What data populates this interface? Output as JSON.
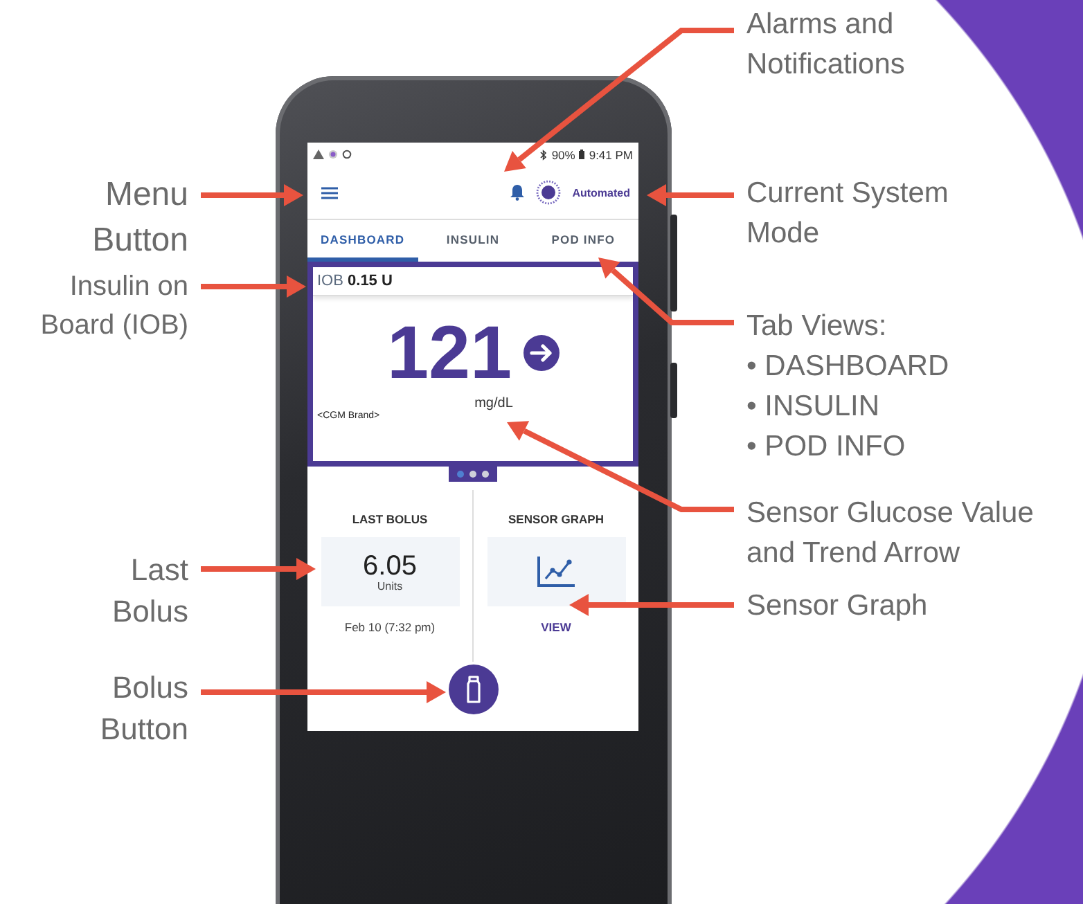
{
  "annotations_left": [
    {
      "text": "Menu\nButton"
    },
    {
      "text": "Insulin on\nBoard (IOB)"
    },
    {
      "text": "Last\nBolus"
    },
    {
      "text": "Bolus\nButton"
    }
  ],
  "annotations_right": [
    {
      "kind": "text",
      "text": "Alarms and\nNotifications"
    },
    {
      "kind": "text",
      "text": "Current System\nMode"
    },
    {
      "kind": "list",
      "text": "Tab Views:",
      "items": [
        "• DASHBOARD",
        "• INSULIN",
        "• POD INFO"
      ]
    },
    {
      "kind": "text",
      "text": "Sensor Glucose Value\nand Trend Arrow"
    },
    {
      "kind": "text",
      "text": "Sensor Graph"
    }
  ],
  "status_bar": {
    "battery": "90%",
    "time": "9:41 PM"
  },
  "app_bar": {
    "mode": "Automated"
  },
  "tabs": [
    {
      "label": "DASHBOARD",
      "selected": true
    },
    {
      "label": "INSULIN",
      "selected": false
    },
    {
      "label": "POD INFO",
      "selected": false
    }
  ],
  "glucose_card": {
    "iob": "IOB **0.15 U**",
    "value": "121",
    "unit": "mg/dL",
    "source": "<CGM Brand>"
  },
  "pager": [
    {
      "selected": true
    },
    {
      "selected": false
    },
    {
      "selected": false
    }
  ],
  "last_bolus": {
    "title": "LAST BOLUS",
    "amount": "6.05",
    "unit": "Units",
    "date": "Feb 10 (7:32 pm)"
  },
  "sensor_graph": {
    "title": "SENSOR GRAPH",
    "link": "VIEW"
  }
}
